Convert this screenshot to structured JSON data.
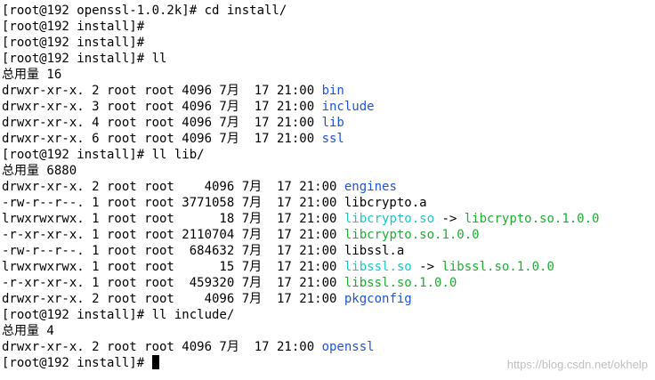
{
  "colors": {
    "dir": "#1f54d8",
    "exec": "#1fad34",
    "symlink": "#19c7c7",
    "text": "#000000",
    "background": "#ffffff"
  },
  "lines": [
    [
      {
        "text": "[root@192 openssl-1.0.2k]# cd install/"
      }
    ],
    [
      {
        "text": "[root@192 install]#"
      }
    ],
    [
      {
        "text": "[root@192 install]#"
      }
    ],
    [
      {
        "text": "[root@192 install]# ll"
      }
    ],
    [
      {
        "text": "总用量 16"
      }
    ],
    [
      {
        "text": "drwxr-xr-x. 2 root root 4096 7月  17 21:00 "
      },
      {
        "text": "bin",
        "color": "dir"
      }
    ],
    [
      {
        "text": "drwxr-xr-x. 3 root root 4096 7月  17 21:00 "
      },
      {
        "text": "include",
        "color": "dir"
      }
    ],
    [
      {
        "text": "drwxr-xr-x. 4 root root 4096 7月  17 21:00 "
      },
      {
        "text": "lib",
        "color": "dir"
      }
    ],
    [
      {
        "text": "drwxr-xr-x. 6 root root 4096 7月  17 21:00 "
      },
      {
        "text": "ssl",
        "color": "dir"
      }
    ],
    [
      {
        "text": "[root@192 install]# ll lib/"
      }
    ],
    [
      {
        "text": "总用量 6880"
      }
    ],
    [
      {
        "text": "drwxr-xr-x. 2 root root    4096 7月  17 21:00 "
      },
      {
        "text": "engines",
        "color": "dir"
      }
    ],
    [
      {
        "text": "-rw-r--r--. 1 root root 3771058 7月  17 21:00 libcrypto.a"
      }
    ],
    [
      {
        "text": "lrwxrwxrwx. 1 root root      18 7月  17 21:00 "
      },
      {
        "text": "libcrypto.so",
        "color": "symlink"
      },
      {
        "text": " -> "
      },
      {
        "text": "libcrypto.so.1.0.0",
        "color": "exec"
      }
    ],
    [
      {
        "text": "-r-xr-xr-x. 1 root root 2110704 7月  17 21:00 "
      },
      {
        "text": "libcrypto.so.1.0.0",
        "color": "exec"
      }
    ],
    [
      {
        "text": "-rw-r--r--. 1 root root  684632 7月  17 21:00 libssl.a"
      }
    ],
    [
      {
        "text": "lrwxrwxrwx. 1 root root      15 7月  17 21:00 "
      },
      {
        "text": "libssl.so",
        "color": "symlink"
      },
      {
        "text": " -> "
      },
      {
        "text": "libssl.so.1.0.0",
        "color": "exec"
      }
    ],
    [
      {
        "text": "-r-xr-xr-x. 1 root root  459320 7月  17 21:00 "
      },
      {
        "text": "libssl.so.1.0.0",
        "color": "exec"
      }
    ],
    [
      {
        "text": "drwxr-xr-x. 2 root root    4096 7月  17 21:00 "
      },
      {
        "text": "pkgconfig",
        "color": "dir"
      }
    ],
    [
      {
        "text": "[root@192 install]# ll include/"
      }
    ],
    [
      {
        "text": "总用量 4"
      }
    ],
    [
      {
        "text": "drwxr-xr-x. 2 root root 4096 7月  17 21:00 "
      },
      {
        "text": "openssl",
        "color": "dir"
      }
    ],
    [
      {
        "text": "[root@192 install]# "
      },
      {
        "cursor": true
      }
    ]
  ],
  "watermark": "https://blog.csdn.net/okhelp"
}
